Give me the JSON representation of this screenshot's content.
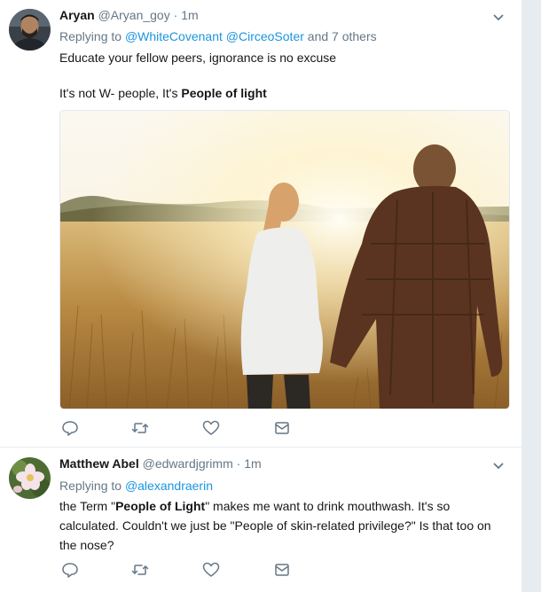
{
  "tweets": [
    {
      "name": "Aryan",
      "handle": "@Aryan_goy",
      "separator": "·",
      "time": "1m",
      "replying_prefix": "Replying to",
      "replying_users": [
        "@WhiteCovenant",
        "@CirceoSoter"
      ],
      "replying_suffix": "and 7 others",
      "line1": "Educate your fellow peers, ignorance is no excuse",
      "line2_prefix": "It's not W- people, It's ",
      "line2_bold": "People of light",
      "media_icon": "photo-couple-in-wheat-field"
    },
    {
      "name": "Matthew Abel",
      "handle": "@edwardjgrimm",
      "separator": "·",
      "time": "1m",
      "replying_prefix": "Replying to",
      "replying_users": [
        "@alexandraerin"
      ],
      "text_prefix": "the Term \"",
      "text_bold": "People of Light",
      "text_suffix": "\" makes me want to drink mouthwash. It's so calculated. Couldn't we just be \"People of skin-related privilege?\" Is that too on the nose?"
    }
  ],
  "icons": {
    "reply": "reply-icon",
    "retweet": "retweet-icon",
    "like": "heart-icon",
    "dm": "envelope-icon",
    "menu": "chevron-down-icon"
  },
  "colors": {
    "link": "#1b95e0",
    "secondary_text": "#657786",
    "icon": "#657786",
    "divider": "#e6ecf0"
  }
}
